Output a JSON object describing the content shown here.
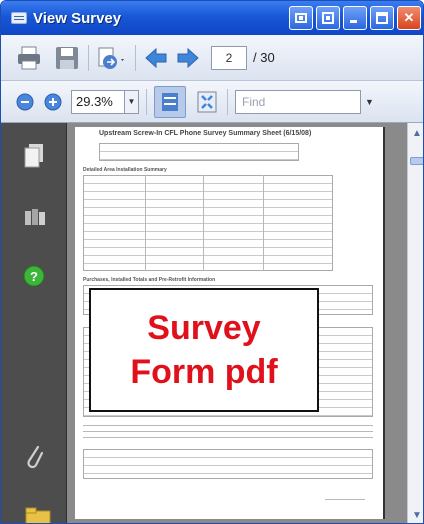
{
  "window": {
    "title": "View Survey",
    "buttons": {
      "help": "?",
      "restore": "",
      "minimize": "",
      "maximize": "",
      "close": "✕"
    }
  },
  "toolbar": {
    "page_current": "2",
    "page_total": "/ 30",
    "zoom_value": "29.3%",
    "find_placeholder": "Find"
  },
  "document": {
    "header": "Upstream Screw-In CFL Phone Survey Summary Sheet (6/15/08)",
    "section_fixture": "Detailed Area Installation Summary",
    "section_purchase": "Purchases, Installed Totals and Pre-Retrofit Information"
  },
  "overlay": {
    "line1": "Survey",
    "line2": "Form pdf"
  },
  "colors": {
    "titlebar": "#1857d6",
    "overlay_text": "#e0111b",
    "panel": "#4d4d4d"
  }
}
